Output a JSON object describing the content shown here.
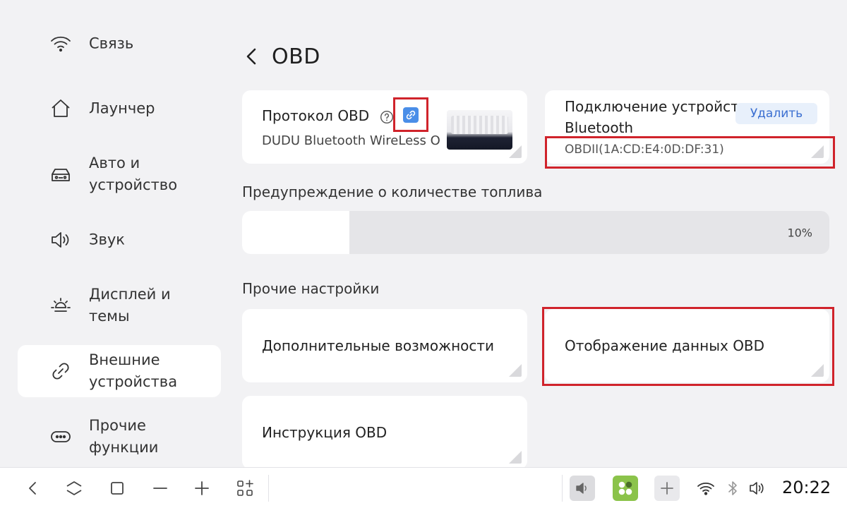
{
  "sidebar": {
    "items": [
      {
        "label": "Связь",
        "icon": "wifi-icon",
        "active": false
      },
      {
        "label": "Лаунчер",
        "icon": "home-icon",
        "active": false
      },
      {
        "label": "Авто и устройство",
        "icon": "car-icon",
        "active": false
      },
      {
        "label": "Звук",
        "icon": "speaker-icon",
        "active": false
      },
      {
        "label": "Дисплей и темы",
        "icon": "sun-icon",
        "active": false
      },
      {
        "label": "Внешние устройства",
        "icon": "link-icon",
        "active": true
      },
      {
        "label": "Прочие функции",
        "icon": "more-icon",
        "active": false
      }
    ]
  },
  "header": {
    "title": "OBD",
    "back_icon": "chevron-left-icon"
  },
  "protocol_card": {
    "title": "Протокол OBD",
    "help_icon": "question-circle-icon",
    "link_icon": "link-icon",
    "subtitle": "DUDU Bluetooth WireLess O",
    "device_image": "obd-adapter-image"
  },
  "bluetooth_card": {
    "title_line1": "Подключение устройст",
    "title_line2": "Bluetooth",
    "delete_label": "Удалить",
    "device_address": "OBDII(1A:CD:E4:0D:DF:31)"
  },
  "fuel_warning": {
    "label": "Предупреждение о количестве топлива",
    "value_text": "10%",
    "fraction": 0.1
  },
  "other_settings": {
    "label": "Прочие настройки",
    "extra_features": "Дополнительные возможности",
    "obd_display": "Отображение данных OBD",
    "obd_instructions": "Инструкция OBD"
  },
  "bottom_bar": {
    "clock": "20:22",
    "icons": [
      "back-icon",
      "home-icon",
      "recents-icon",
      "minus-icon",
      "plus-icon",
      "apps-icon",
      "volume-tile-icon",
      "app-tile-icon",
      "add-tile-icon",
      "wifi-icon",
      "bluetooth-icon",
      "volume-icon"
    ]
  },
  "colors": {
    "accent": "#4a8ee8",
    "highlight_frame": "#d0232b",
    "background": "#f2f2f4",
    "delete_text": "#3b6fd1"
  }
}
